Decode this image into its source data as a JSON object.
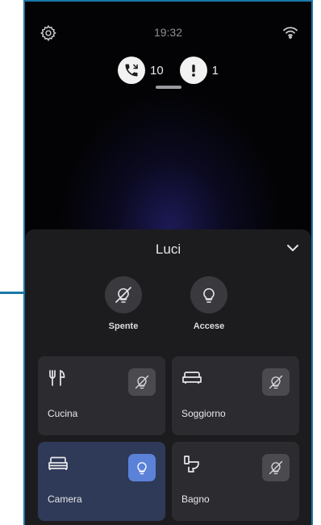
{
  "status": {
    "time": "19:32",
    "calls_count": "10",
    "alerts_count": "1"
  },
  "icons": {
    "settings": "gear-icon",
    "wifi": "wifi-icon",
    "calls": "phone-icon",
    "alerts": "exclamation-icon"
  },
  "sheet": {
    "title": "Luci",
    "quick": [
      {
        "label": "Spente",
        "icon": "bulb-off-icon"
      },
      {
        "label": "Accese",
        "icon": "bulb-on-icon"
      }
    ],
    "rooms": [
      {
        "name": "Cucina",
        "icon": "cutlery-icon",
        "state": "off"
      },
      {
        "name": "Soggiorno",
        "icon": "sofa-icon",
        "state": "off"
      },
      {
        "name": "Camera",
        "icon": "bed-icon",
        "state": "on"
      },
      {
        "name": "Bagno",
        "icon": "toilet-icon",
        "state": "off"
      }
    ]
  },
  "colors": {
    "background": "#030305",
    "sheet": "#1c1c1f",
    "tile": "#2c2c30",
    "tile_active": "#2e3a58",
    "accent": "#5b82d8",
    "pointer": "#1a78a8"
  }
}
